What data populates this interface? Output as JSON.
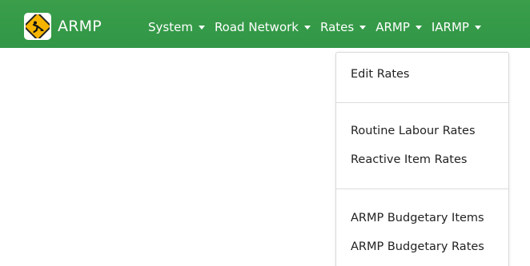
{
  "app": {
    "name": "ARMP",
    "logo_icon": "road-works-sign-icon"
  },
  "colors": {
    "navbar": "#35994a",
    "nav_text": "#ffffff",
    "menu_text": "#222222",
    "divider": "#dcdcdc"
  },
  "navbar": {
    "items": [
      {
        "label": "System"
      },
      {
        "label": "Road Network"
      },
      {
        "label": "Rates"
      },
      {
        "label": "ARMP"
      },
      {
        "label": "IARMP"
      }
    ]
  },
  "dropdown": {
    "parent": "Rates",
    "groups": [
      {
        "items": [
          {
            "label": "Edit Rates"
          }
        ]
      },
      {
        "items": [
          {
            "label": "Routine Labour Rates"
          },
          {
            "label": "Reactive Item Rates"
          }
        ]
      },
      {
        "items": [
          {
            "label": "ARMP Budgetary Items"
          },
          {
            "label": "ARMP Budgetary Rates"
          }
        ]
      }
    ]
  }
}
